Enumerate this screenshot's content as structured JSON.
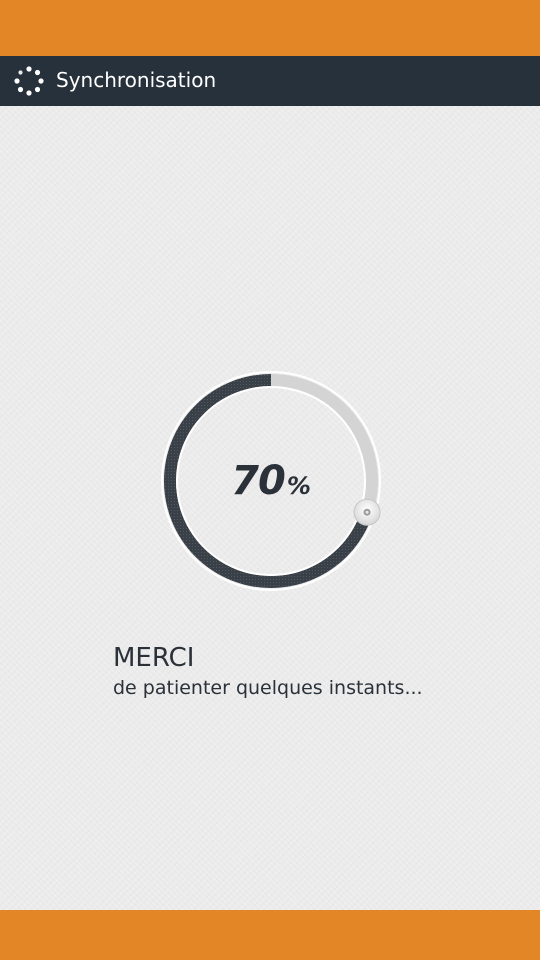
{
  "colors": {
    "accent": "#e38626",
    "header_bg": "#27313b",
    "text_dark": "#2b3139",
    "ring_track": "#d4d4d4",
    "ring_fill": "#3a4048"
  },
  "header": {
    "icon": "loading-spinner-icon",
    "title": "Synchronisation"
  },
  "progress": {
    "value": 0.7,
    "number": "70",
    "percent_sign": "%"
  },
  "message": {
    "title": "MERCI",
    "subtitle": "de patienter quelques instants..."
  }
}
